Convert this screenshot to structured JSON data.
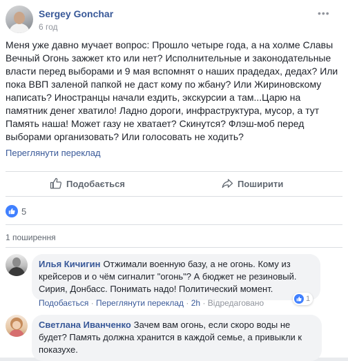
{
  "post": {
    "author": "Sergey Gonchar",
    "time": "6 год",
    "text": "Меня уже давно мучает вопрос: Прошло четыре года, а на холме Славы Вечный Огонь зажжет кто или нет? Исполнительные и законодательные власти перед выборами и 9 мая вспомнят о наших прадедах, дедах? Или пока ВВП заленой папкой не даст кому по жбану? Или Жириновскому написать? Иностранцы начали ездить, экскурсии а там...Царю на памятник денег хватило! Ладно дороги, инфраструктура, мусор, а тут Память наша! Может газу не хватает? Скинутся? Флэш-моб перед выборами организовать? Или голосовать не ходить?",
    "translate_link": "Переглянути переклад"
  },
  "actions": {
    "like_label": "Подобається",
    "share_label": "Поширити"
  },
  "reactions": {
    "like_count": "5"
  },
  "shares": {
    "label": "1 поширення"
  },
  "comments": [
    {
      "name": "Илья Кичигин",
      "text": "Отжимали военную базу, а не огонь. Кому из крейсеров и о чём сигналит \"огонь\"? А бюджет не резиновый. Сирия, Донбасс. Понимать надо! Политический момент.",
      "like_label": "Подобається",
      "sep1": "·",
      "translate_label": "Переглянути переклад",
      "sep2": "·",
      "time": "2h",
      "sep3": "·",
      "edited_label": "Відредаговано",
      "reaction_count": "1"
    },
    {
      "name": "Светлана Иванченко",
      "text": "Зачем вам огонь, если скоро воды не будет? Память должна хранится в каждой семье, а привыкли к показухе."
    }
  ],
  "colors": {
    "link": "#385898",
    "like_blue": "#4080ff",
    "meta_gray": "#90949c",
    "bubble_bg": "#f2f3f5"
  }
}
